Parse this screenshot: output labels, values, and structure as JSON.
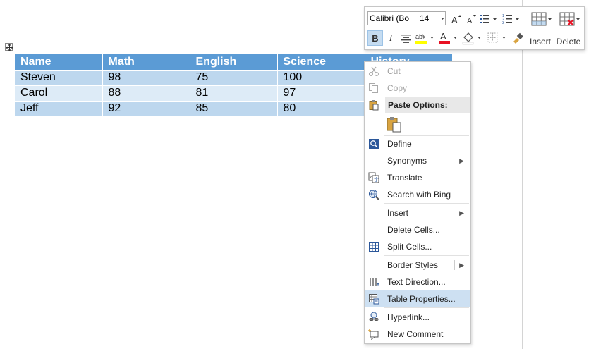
{
  "table": {
    "headers": [
      "Name",
      "Math",
      "English",
      "Science",
      "History"
    ],
    "rows": [
      [
        "Steven",
        "98",
        "75",
        "100"
      ],
      [
        "Carol",
        "88",
        "81",
        "97"
      ],
      [
        "Jeff",
        "92",
        "85",
        "80"
      ]
    ]
  },
  "mini_toolbar": {
    "font": "Calibri (Bo",
    "size": "14",
    "insert_label": "Insert",
    "delete_label": "Delete",
    "bold_label": "B",
    "italic_label": "I"
  },
  "context_menu": {
    "cut": "Cut",
    "copy": "Copy",
    "paste_options": "Paste Options:",
    "define": "Define",
    "synonyms": "Synonyms",
    "translate": "Translate",
    "search_bing": "Search with Bing",
    "insert": "Insert",
    "delete_cells": "Delete Cells...",
    "split_cells": "Split Cells...",
    "border_styles": "Border Styles",
    "text_direction": "Text Direction...",
    "table_properties": "Table Properties...",
    "hyperlink": "Hyperlink...",
    "new_comment": "New Comment"
  },
  "colors": {
    "header_fill": "#5b9bd5",
    "row_dark": "#bdd7ee",
    "row_light": "#ddebf7",
    "font_color": "#e81123",
    "highlight": "#ffff00",
    "menu_highlight": "#cde0f2"
  }
}
